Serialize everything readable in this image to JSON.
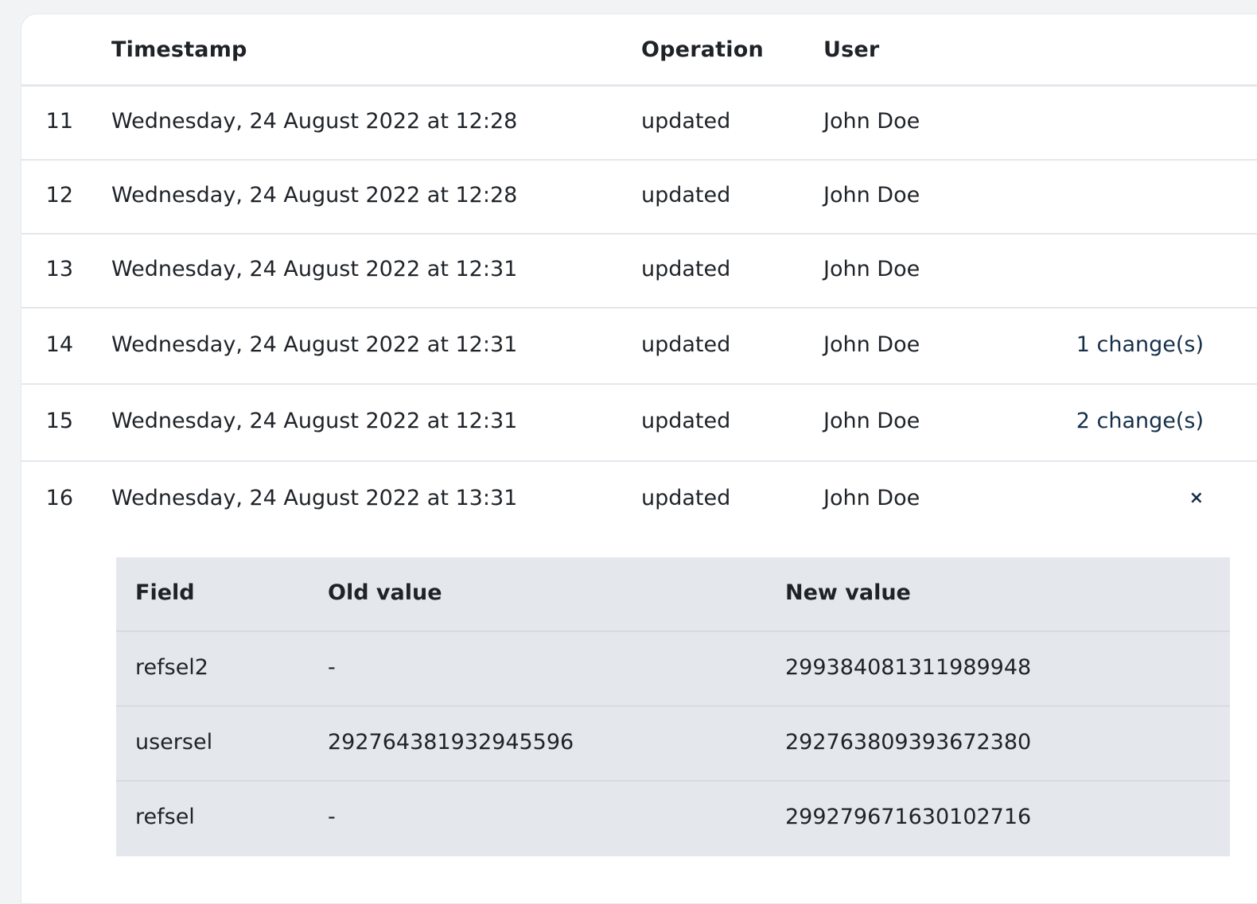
{
  "table": {
    "headers": {
      "timestamp": "Timestamp",
      "operation": "Operation",
      "user": "User"
    },
    "rows": [
      {
        "num": "11",
        "timestamp": "Wednesday, 24 August 2022 at 12:28",
        "operation": "updated",
        "user": "John Doe",
        "changes": ""
      },
      {
        "num": "12",
        "timestamp": "Wednesday, 24 August 2022 at 12:28",
        "operation": "updated",
        "user": "John Doe",
        "changes": ""
      },
      {
        "num": "13",
        "timestamp": "Wednesday, 24 August 2022 at 12:31",
        "operation": "updated",
        "user": "John Doe",
        "changes": ""
      },
      {
        "num": "14",
        "timestamp": "Wednesday, 24 August 2022 at 12:31",
        "operation": "updated",
        "user": "John Doe",
        "changes": "1 change(s)"
      },
      {
        "num": "15",
        "timestamp": "Wednesday, 24 August 2022 at 12:31",
        "operation": "updated",
        "user": "John Doe",
        "changes": "2 change(s)"
      },
      {
        "num": "16",
        "timestamp": "Wednesday, 24 August 2022 at 13:31",
        "operation": "updated",
        "user": "John Doe",
        "changes": "×"
      }
    ]
  },
  "details": {
    "headers": {
      "field": "Field",
      "old_value": "Old value",
      "new_value": "New value"
    },
    "rows": [
      {
        "field": "refsel2",
        "old_value": "-",
        "new_value": "299384081311989948"
      },
      {
        "field": "usersel",
        "old_value": "292764381932945596",
        "new_value": "292763809393672380"
      },
      {
        "field": "refsel",
        "old_value": "-",
        "new_value": "299279671630102716"
      }
    ]
  },
  "colors": {
    "link": "#163049",
    "detail_bg": "#e4e7ec",
    "page_bg": "#f2f3f5"
  }
}
